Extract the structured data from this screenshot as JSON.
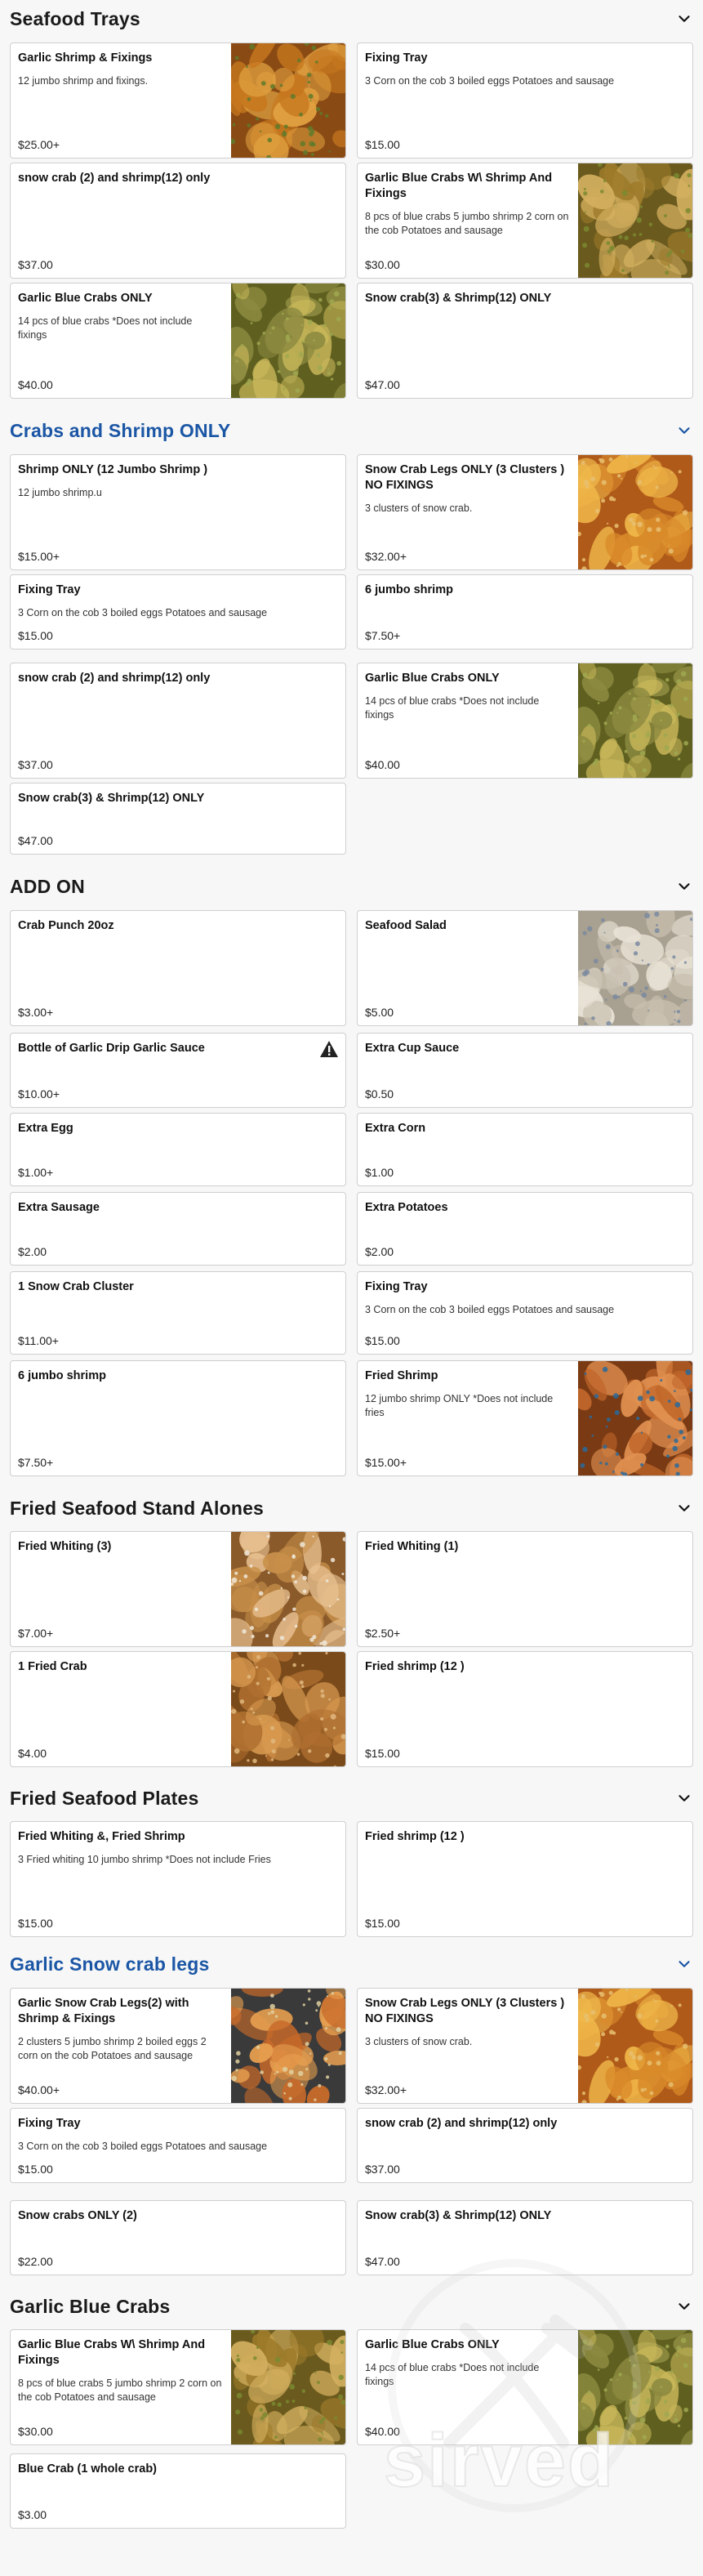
{
  "brand_watermark": "sirved",
  "colors": {
    "blue_heading": "#1b56a5",
    "card_border": "#cfcfcf",
    "background": "#f7f7f7"
  },
  "icons": {
    "expand": "chevron-down-icon",
    "warning": "warning-triangle-icon"
  },
  "sections": [
    {
      "title": "Seafood Trays",
      "blue": false,
      "items": [
        {
          "name": "Garlic Shrimp & Fixings",
          "desc": "12 jumbo shrimp and fixings.",
          "price": "$25.00+",
          "image": "garlic-shrimp-photo"
        },
        {
          "name": "Fixing Tray",
          "desc": "3 Corn on the cob 3 boiled eggs Potatoes and sausage",
          "price": "$15.00"
        },
        {
          "name": "snow crab (2) and shrimp(12) only",
          "desc": "",
          "price": "$37.00"
        },
        {
          "name": "Garlic Blue Crabs W\\ Shrimp And Fixings",
          "desc": "8 pcs of blue crabs 5 jumbo shrimp 2 corn on the cob Potatoes and sausage",
          "price": "$30.00",
          "image": "garlic-blue-crabs-photo"
        },
        {
          "name": "Garlic Blue Crabs ONLY",
          "desc": "14 pcs of blue crabs *Does not include fixings",
          "price": "$40.00",
          "image": "garlic-blue-crabs-only-photo"
        },
        {
          "name": "Snow crab(3) & Shrimp(12) ONLY",
          "desc": "",
          "price": "$47.00"
        }
      ]
    },
    {
      "title": "Crabs and Shrimp ONLY",
      "blue": true,
      "items": [
        {
          "name": "Shrimp ONLY (12 Jumbo Shrimp )",
          "desc": "12 jumbo shrimp.u",
          "price": "$15.00+"
        },
        {
          "name": "Snow Crab Legs ONLY (3 Clusters ) NO FIXINGS",
          "desc": "3 clusters of snow crab.",
          "price": "$32.00+",
          "image": "snow-crab-legs-photo"
        },
        {
          "name": "Fixing Tray",
          "desc": "3 Corn on the cob 3 boiled eggs Potatoes and sausage",
          "price": "$15.00"
        },
        {
          "name": "6 jumbo shrimp",
          "desc": "",
          "price": "$7.50+"
        },
        {
          "name": "snow crab (2) and shrimp(12) only",
          "desc": "",
          "price": "$37.00"
        },
        {
          "name": "Garlic Blue Crabs ONLY",
          "desc": "14 pcs of blue crabs *Does not include fixings",
          "price": "$40.00",
          "image": "garlic-blue-crabs-only-photo"
        },
        {
          "name": "Snow crab(3) & Shrimp(12) ONLY",
          "desc": "",
          "price": "$47.00"
        }
      ]
    },
    {
      "title": "ADD ON",
      "blue": false,
      "items": [
        {
          "name": "Crab Punch 20oz",
          "desc": "",
          "price": "$3.00+"
        },
        {
          "name": "Seafood Salad",
          "desc": "",
          "price": "$5.00",
          "image": "seafood-salad-photo"
        },
        {
          "name": "Bottle of Garlic Drip Garlic Sauce",
          "desc": "",
          "price": "$10.00+",
          "warning": true
        },
        {
          "name": "Extra Cup Sauce",
          "desc": "",
          "price": "$0.50"
        },
        {
          "name": "Extra Egg",
          "desc": "",
          "price": "$1.00+"
        },
        {
          "name": "Extra Corn",
          "desc": "",
          "price": "$1.00"
        },
        {
          "name": "Extra Sausage",
          "desc": "",
          "price": "$2.00"
        },
        {
          "name": "Extra Potatoes",
          "desc": "",
          "price": "$2.00"
        },
        {
          "name": "1 Snow Crab Cluster",
          "desc": "",
          "price": "$11.00+"
        },
        {
          "name": "Fixing Tray",
          "desc": "3 Corn on the cob 3 boiled eggs Potatoes and sausage",
          "price": "$15.00"
        },
        {
          "name": "6 jumbo shrimp",
          "desc": "",
          "price": "$7.50+"
        },
        {
          "name": "Fried Shrimp",
          "desc": "12 jumbo shrimp ONLY *Does not include fries",
          "price": "$15.00+",
          "image": "fried-shrimp-photo"
        }
      ]
    },
    {
      "title": "Fried Seafood Stand Alones",
      "blue": false,
      "items": [
        {
          "name": "Fried Whiting (3)",
          "desc": "",
          "price": "$7.00+",
          "image": "fried-whiting-photo"
        },
        {
          "name": "Fried Whiting (1)",
          "desc": "",
          "price": "$2.50+"
        },
        {
          "name": "1 Fried Crab",
          "desc": "",
          "price": "$4.00",
          "image": "fried-crab-photo"
        },
        {
          "name": "Fried shrimp (12 )",
          "desc": "",
          "price": "$15.00"
        }
      ]
    },
    {
      "title": "Fried Seafood Plates",
      "blue": false,
      "items": [
        {
          "name": "Fried Whiting &, Fried Shrimp",
          "desc": "3 Fried whiting 10 jumbo shrimp *Does not include Fries",
          "price": "$15.00"
        },
        {
          "name": "Fried shrimp (12 )",
          "desc": "",
          "price": "$15.00"
        }
      ]
    },
    {
      "title": "Garlic Snow crab legs",
      "blue": true,
      "items": [
        {
          "name": "Garlic Snow Crab Legs(2) with Shrimp & Fixings",
          "desc": "2 clusters 5 jumbo shrimp 2 boiled eggs 2 corn on the cob Potatoes and sausage",
          "price": "$40.00+",
          "image": "garlic-snow-crab-photo"
        },
        {
          "name": "Snow Crab Legs ONLY (3 Clusters ) NO FIXINGS",
          "desc": "3 clusters of snow crab.",
          "price": "$32.00+",
          "image": "snow-crab-legs-photo"
        },
        {
          "name": "Fixing Tray",
          "desc": "3 Corn on the cob 3 boiled eggs Potatoes and sausage",
          "price": "$15.00"
        },
        {
          "name": "snow crab (2) and shrimp(12) only",
          "desc": "",
          "price": "$37.00"
        },
        {
          "name": "Snow crabs ONLY (2)",
          "desc": "",
          "price": "$22.00"
        },
        {
          "name": "Snow crab(3) & Shrimp(12) ONLY",
          "desc": "",
          "price": "$47.00"
        }
      ]
    },
    {
      "title": "Garlic Blue Crabs",
      "blue": false,
      "items": [
        {
          "name": "Garlic Blue Crabs W\\ Shrimp And Fixings",
          "desc": "8 pcs of blue crabs 5 jumbo shrimp 2 corn on the cob Potatoes and sausage",
          "price": "$30.00",
          "image": "garlic-blue-crabs-photo"
        },
        {
          "name": "Garlic Blue Crabs ONLY",
          "desc": "14 pcs of blue crabs *Does not include fixings",
          "price": "$40.00",
          "image": "garlic-blue-crabs-only-photo"
        },
        {
          "name": "Blue Crab (1 whole crab)",
          "desc": "",
          "price": "$3.00"
        }
      ]
    }
  ]
}
